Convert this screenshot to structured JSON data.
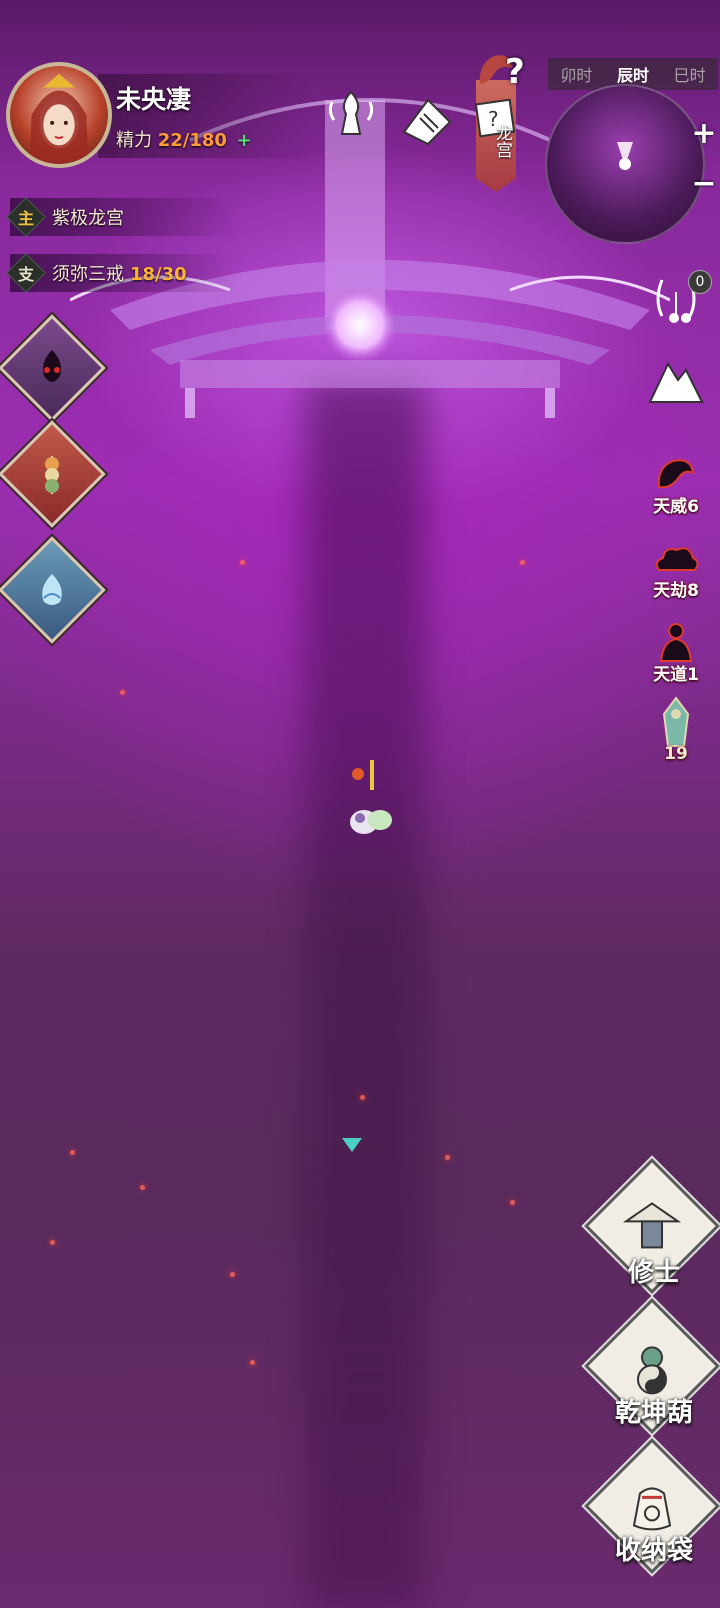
{
  "player": {
    "name": "未央凄",
    "energy_label": "精力",
    "energy_value": "22/180",
    "energy_add": "+"
  },
  "quests": [
    {
      "tag": "主",
      "tag_color": "#f0c040",
      "title": "紫极龙宫",
      "progress": ""
    },
    {
      "tag": "支",
      "tag_color": "#e8e0c8",
      "title": "须弥三戒",
      "progress": "18/30"
    }
  ],
  "location_banner": {
    "text": "龙宫",
    "help": "?"
  },
  "time_bar": {
    "segments": [
      "卯时",
      "辰时",
      "巳时"
    ],
    "active_index": 1
  },
  "minimap": {
    "zoom_in": "+",
    "zoom_out": "−"
  },
  "right_panel": {
    "music_badge": "0",
    "items": [
      {
        "label": "天威6",
        "icon": "dragon-icon"
      },
      {
        "label": "天劫8",
        "icon": "cloud-icon"
      },
      {
        "label": "天道1",
        "icon": "buddha-icon"
      },
      {
        "label": "19",
        "icon": "spirit-statue-icon"
      }
    ]
  },
  "actions": [
    {
      "label": "修士",
      "icon": "cultivator-icon"
    },
    {
      "label": "乾坤葫",
      "icon": "gourd-icon"
    },
    {
      "label": "收纳袋",
      "icon": "bag-icon"
    }
  ],
  "colors": {
    "accent_orange": "#ff9a3a",
    "accent_green": "#55e07a",
    "progress_gold": "#ffb23a",
    "background_purple": "#8a2a9e"
  }
}
